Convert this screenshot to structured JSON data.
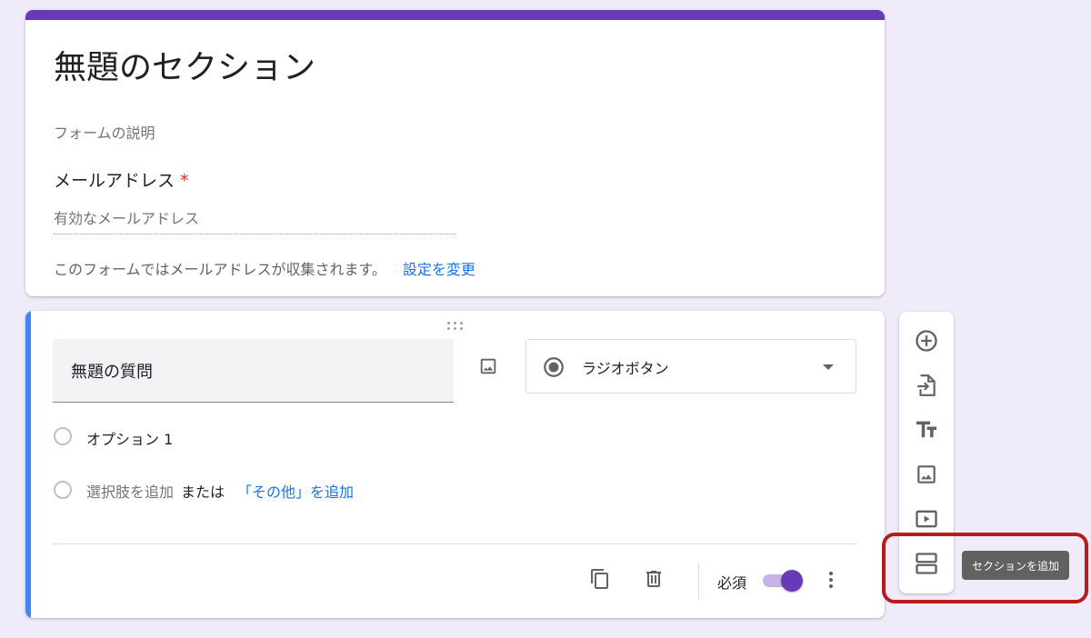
{
  "header": {
    "title": "無題のセクション",
    "description_placeholder": "フォームの説明",
    "email_label": "メールアドレス",
    "required_mark": "*",
    "email_placeholder": "有効なメールアドレス",
    "collect_note": "このフォームではメールアドレスが収集されます。",
    "change_settings_link": "設定を変更"
  },
  "question": {
    "title": "無題の質問",
    "type_label": "ラジオボタン",
    "options": [
      {
        "label": "オプション 1"
      }
    ],
    "add_option_link": "選択肢を追加",
    "or_text": "または",
    "add_other_link": "「その他」を追加",
    "required_label": "必須",
    "required_on": true
  },
  "toolbar": {
    "items": [
      {
        "name": "add-question",
        "icon": "add-circle-icon"
      },
      {
        "name": "import-questions",
        "icon": "import-icon"
      },
      {
        "name": "add-title",
        "icon": "title-icon"
      },
      {
        "name": "add-image",
        "icon": "image-icon"
      },
      {
        "name": "add-video",
        "icon": "video-icon"
      },
      {
        "name": "add-section",
        "icon": "section-icon"
      }
    ],
    "tooltip": "セクションを追加"
  },
  "colors": {
    "accent": "#673ab7",
    "background": "#f0ebf8",
    "link": "#1a73e8",
    "question_accent": "#4285f4",
    "highlight": "#b71c1c"
  }
}
